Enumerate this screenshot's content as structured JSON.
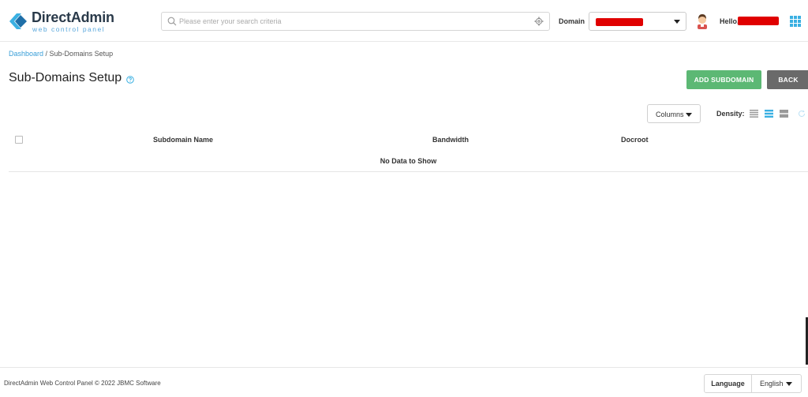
{
  "brand": {
    "name": "DirectAdmin",
    "tagline": "web control panel",
    "colors": {
      "primary": "#3ab0e2",
      "dark": "#2a3a4a"
    }
  },
  "search": {
    "placeholder": "Please enter your search criteria",
    "value": ""
  },
  "header": {
    "domain_label": "Domain",
    "hello": "Hello,"
  },
  "breadcrumb": {
    "home": "Dashboard",
    "separator": " / ",
    "current": "Sub-Domains Setup"
  },
  "page": {
    "title": "Sub-Domains Setup"
  },
  "actions": {
    "add": "ADD SUBDOMAIN",
    "back": "BACK"
  },
  "toolbar": {
    "columns": "Columns",
    "density": "Density:"
  },
  "table": {
    "columns": [
      "Subdomain Name",
      "Bandwidth",
      "Docroot"
    ],
    "empty": "No Data to Show"
  },
  "footer": {
    "copyright": "DirectAdmin Web Control Panel © 2022 JBMC Software",
    "language_label": "Language",
    "language_value": "English"
  },
  "colors": {
    "add_button": "#5cb874",
    "back_button": "#6a6a6a",
    "link": "#3a9fd8",
    "redaction": "#e00000"
  }
}
